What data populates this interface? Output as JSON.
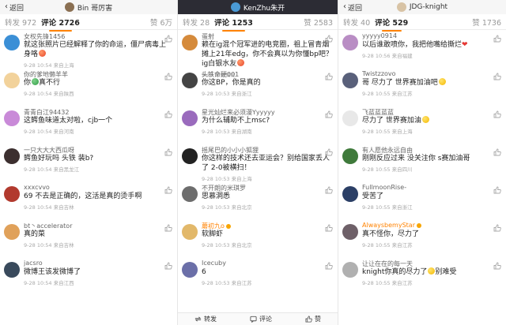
{
  "colors": {
    "accent": "#ff8200",
    "dark_header": "#2c2c34",
    "name_gray": "#666666",
    "meta_gray": "#aaaaaa"
  },
  "panels": [
    {
      "id": "p1",
      "header": {
        "style": "light",
        "back_label": "返回",
        "title": "Bin 哥厉害"
      },
      "tabs": {
        "repost": "转发 972",
        "comment": "评论 2726",
        "like": "赞 6万"
      },
      "comments": [
        {
          "name": "女权先锋1456",
          "text": "就这张照片已经解释了你的命运，僵尸病毒上身咯",
          "emoji": "red",
          "meta": "9-28 10:54 来自上海",
          "avatar": "#3b8fd6",
          "liked": false
        },
        {
          "name": "你的爹地懒羊羊",
          "text": "你",
          "emoji": "green",
          "text_after": "真不行",
          "meta": "9-28 10:54 来自陕西",
          "avatar": "#f2d29b",
          "liked": false
        },
        {
          "name": "青青白江94432",
          "text": "这鳄鱼味道太对啦，cjb一个",
          "meta": "9-28 10:54 来自河南",
          "avatar": "#c98ad8",
          "liked": false
        },
        {
          "name": "一只大大大西瓜呀",
          "text": "鳄鱼好玩吗 头铁 装b?",
          "meta": "9-28 10:54 来自黑龙江",
          "avatar": "#3c2f2f",
          "liked": false
        },
        {
          "name": "xxxcvvo",
          "text": "69 不去是正确的，这活是真的烫手啊",
          "meta": "9-28 10:54 来自吉林",
          "avatar": "#b23a2e",
          "liked": false
        },
        {
          "name": "bt丶accelerator",
          "text": "真的菜",
          "meta": "9-28 10:54 来自吉林",
          "avatar": "#e0a15a",
          "liked": false
        },
        {
          "name": "jacsro",
          "text": "微博王该发微博了",
          "meta": "9-28 10:54 来自江西",
          "avatar": "#394a5c",
          "liked": false
        }
      ]
    },
    {
      "id": "p2",
      "header": {
        "style": "dark",
        "back_label": "",
        "title": "KenZhu朱开"
      },
      "tabs": {
        "repost": "转发 28",
        "comment": "评论 1253",
        "like": "赞 2583"
      },
      "comments": [
        {
          "name": "蛋射",
          "text": "赖在ig混个冠军进的电竞圈，祖上冒青烟摊上21年edg，你不会真以为你懂bp吧？ig白银水友",
          "emoji": "red",
          "meta": "9-28 来自湖北",
          "avatar": "#d58a3b",
          "liked": false
        },
        {
          "name": "头铁命硬001",
          "text": "你这BP，你是真的",
          "meta": "9-28 10:53 来自浙江",
          "avatar": "#444444",
          "liked": false
        },
        {
          "name": "星光灿烂来必须漫Yyyyyy",
          "text": "为什么辅助不上msc?",
          "meta": "9-28 10:53 来自湖南",
          "avatar": "#9a6bbd",
          "liked": false
        },
        {
          "name": "摇尾巴的小小小狐狸",
          "text": "你这样的技术还去亚运会？别给国家丢人了 2-0被横扫！",
          "meta": "9-28 10:53 来自上海",
          "avatar": "#222222",
          "liked": false
        },
        {
          "name": "不开朗的米琪罗",
          "text": "思慕洞悉",
          "meta": "9-28 10:53 来自北京",
          "avatar": "#6d6d6d",
          "liked": false
        },
        {
          "name": "蘑初九o",
          "text": "软脚虾",
          "meta": "9-28 10:53 来自北京",
          "avatar": "#e2b86a",
          "liked": false,
          "orange": true
        },
        {
          "name": "Icecuby",
          "text": "6",
          "meta": "9-28 10:53 来自江苏",
          "avatar": "#6b6fa8",
          "liked": false
        }
      ],
      "bottombar": {
        "repost": "转发",
        "comment": "评论",
        "like": "赞"
      }
    },
    {
      "id": "p3",
      "header": {
        "style": "light",
        "back_label": "返回",
        "title": "JDG-knight"
      },
      "tabs": {
        "repost": "转发 40",
        "comment": "评论 529",
        "like": "赞 1736"
      },
      "comments": [
        {
          "name": "yyyyy0914",
          "text": "以后谁敢喷你，我把他嘴给撕烂",
          "emoji": "heart",
          "meta": "9-28 10:56 来自福建",
          "avatar": "#b98dc4",
          "liked": false
        },
        {
          "name": "Twistzzovo",
          "text": "哥 尽力了 世界赛加油吧",
          "emoji": "yellow",
          "meta": "9-28 10:55 来自江苏",
          "avatar": "#59607a",
          "liked": false
        },
        {
          "name": "飞蓝蓝蓝蓝",
          "text": "尽力了 世界赛加油",
          "emoji": "yellow",
          "meta": "9-28 10:55 来自上海",
          "avatar": "#e8e8e8",
          "liked": false
        },
        {
          "name": "有人愿他永远自由",
          "text": "刚刚反应过来 没关注你 s赛加油哥",
          "meta": "9-28 10:55 来自四川",
          "avatar": "#3f7a3b",
          "liked": false
        },
        {
          "name": "FullmoonRise-",
          "text": "受苦了",
          "meta": "9-28 10:55 来自浙江",
          "avatar": "#2b3f66",
          "liked": false
        },
        {
          "name": "AlwaysbemyStar",
          "text": "真不怪你，尽力了",
          "meta": "9-28 10:55 来自江苏",
          "avatar": "#6e6068",
          "liked": false,
          "orange": true
        },
        {
          "name": "让让在在的每一天",
          "text": "knight你真的尽力了",
          "emoji": "yellow",
          "text_after": "别难受",
          "meta": "9-28 10:55 来自江苏",
          "avatar": "#b0b0b0",
          "liked": false
        }
      ]
    }
  ]
}
